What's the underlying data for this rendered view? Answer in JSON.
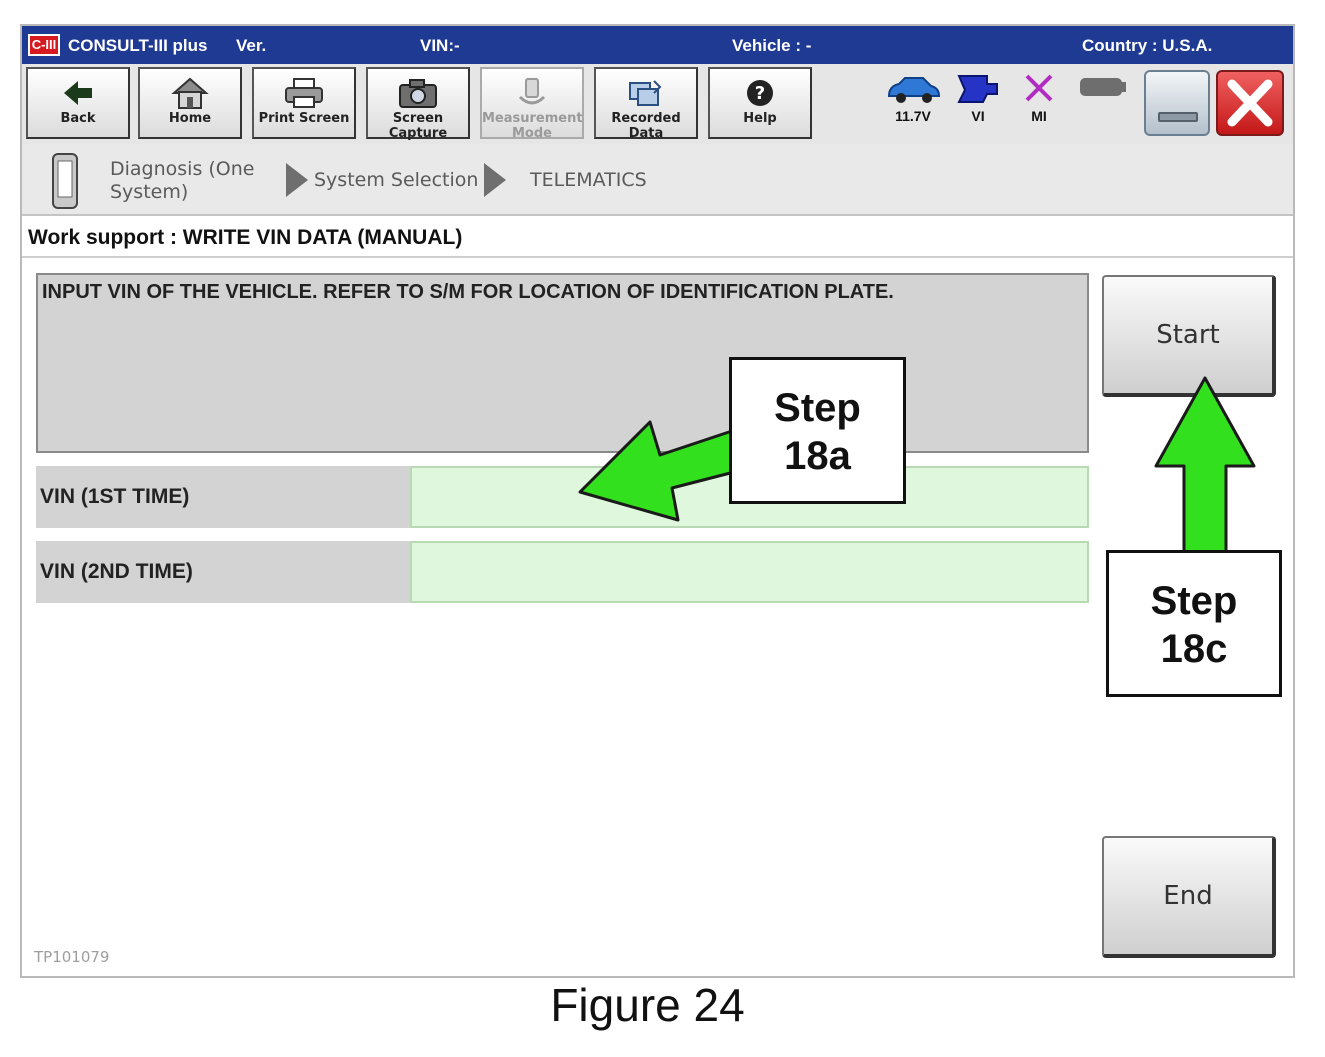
{
  "titlebar": {
    "logo": "C-III",
    "app": "CONSULT-III plus",
    "version_label": "Ver.",
    "vin_label": "VIN:-",
    "vehicle_label": "Vehicle : -",
    "country_label": "Country : U.S.A."
  },
  "toolbar": {
    "buttons": [
      {
        "label": "Back",
        "icon": "arrow-left-icon",
        "enabled": true
      },
      {
        "label": "Home",
        "icon": "house-icon",
        "enabled": true
      },
      {
        "label": "Print Screen",
        "icon": "printer-icon",
        "enabled": true
      },
      {
        "label": "Screen Capture",
        "icon": "camera-icon",
        "enabled": true
      },
      {
        "label": "Measurement Mode",
        "icon": "measurement-icon",
        "enabled": false
      },
      {
        "label": "Recorded Data",
        "icon": "recorded-data-icon",
        "enabled": true
      },
      {
        "label": "Help",
        "icon": "help-icon",
        "enabled": true
      }
    ],
    "status": {
      "voltage": "11.7V",
      "vi_label": "VI",
      "mi_label": "MI"
    }
  },
  "breadcrumb": {
    "items": [
      "Diagnosis (One System)",
      "System Selection",
      "TELEMATICS"
    ]
  },
  "work_support": {
    "title": "Work support : WRITE VIN DATA (MANUAL)",
    "instruction": "INPUT VIN OF THE VEHICLE. REFER TO S/M FOR LOCATION OF IDENTIFICATION PLATE.",
    "fields": [
      {
        "label": "VIN (1ST TIME)",
        "value": ""
      },
      {
        "label": "VIN (2ND TIME)",
        "value": ""
      }
    ],
    "start_label": "Start",
    "end_label": "End"
  },
  "image_id": "TP101079",
  "callouts": {
    "step_a": {
      "line1": "Step",
      "line2": "18a"
    },
    "step_c": {
      "line1": "Step",
      "line2": "18c"
    }
  },
  "caption": "Figure 24",
  "colors": {
    "titlebar": "#1f3a93",
    "arrow_fill": "#33e01e",
    "input_bg": "#dff7dc",
    "close_button": "#d42222"
  }
}
